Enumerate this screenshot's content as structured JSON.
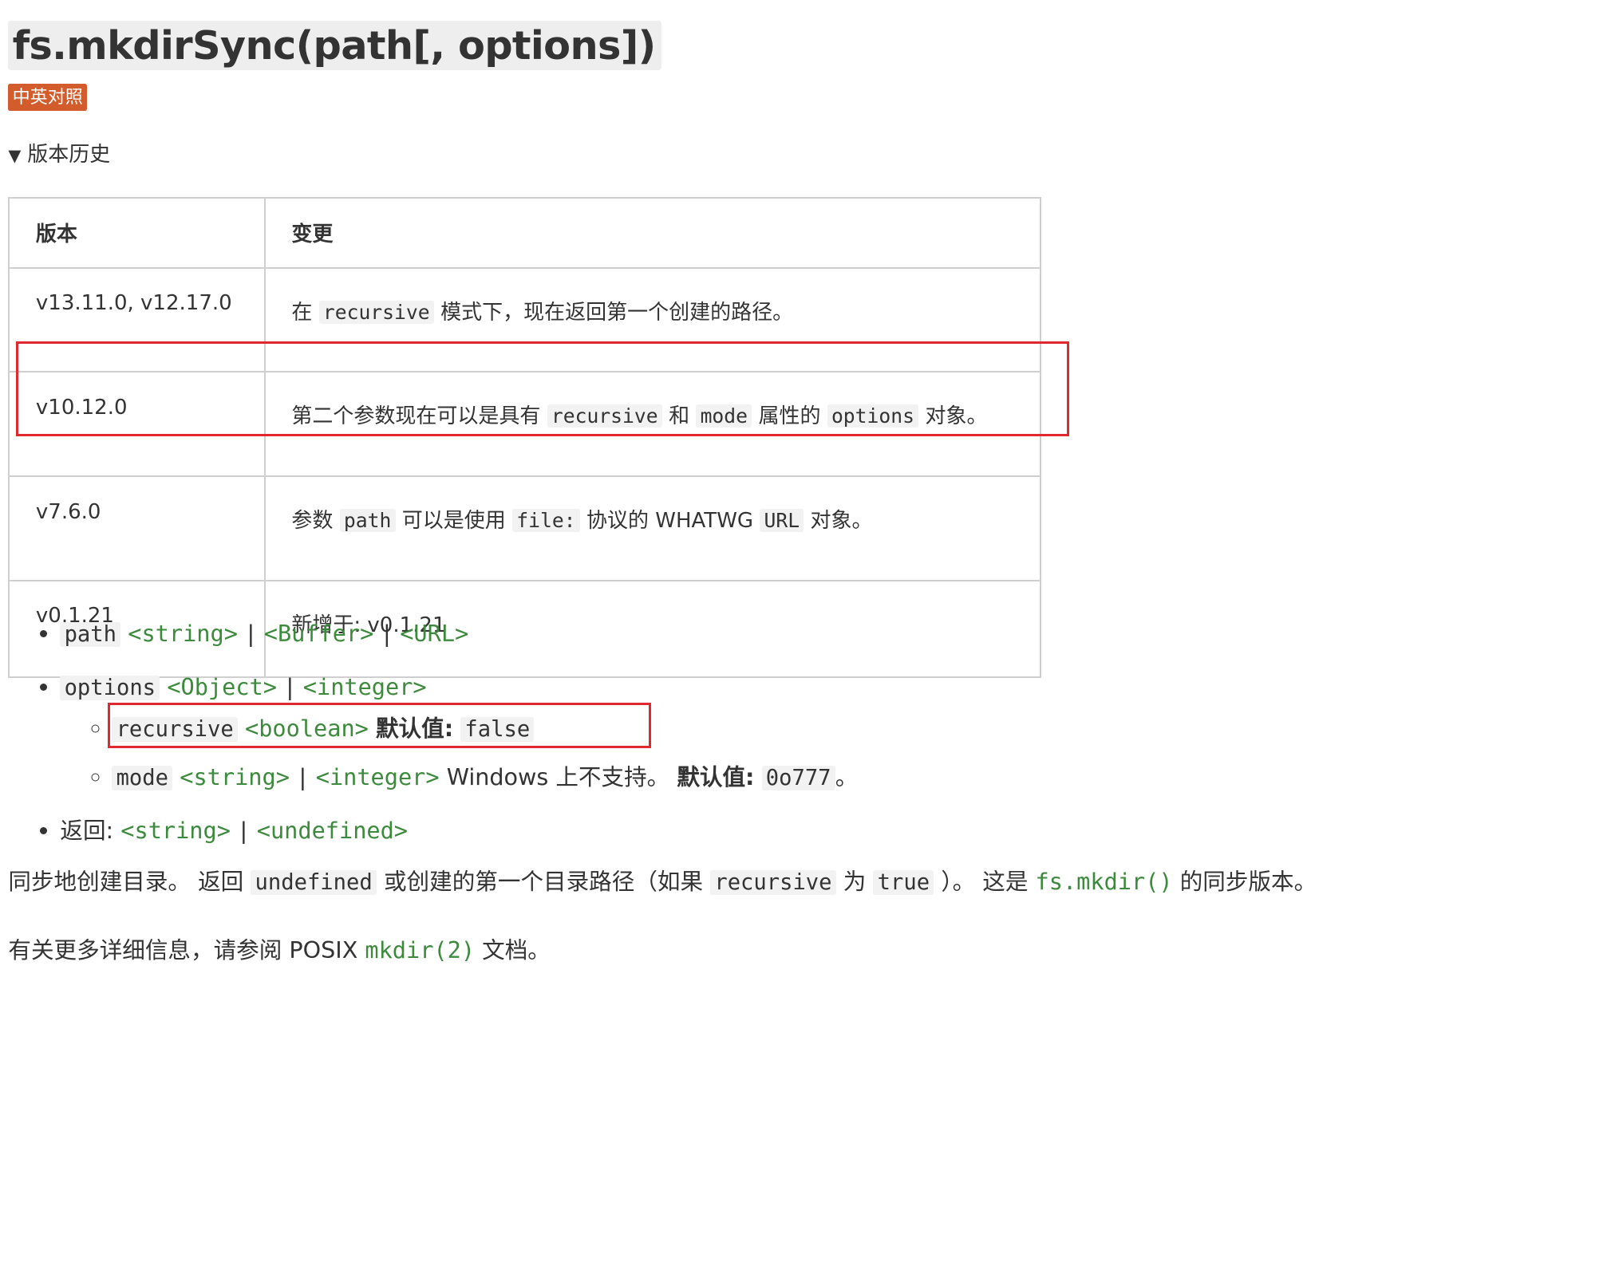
{
  "title": "fs.mkdirSync(path[, options])",
  "badge": "中英对照",
  "history": {
    "toggle_label": "版本历史",
    "headers": {
      "version": "版本",
      "change": "变更"
    },
    "rows": [
      {
        "version": "v13.11.0, v12.17.0",
        "c0": "在",
        "code0": "recursive",
        "c1": "模式下，现在返回第一个创建的路径。"
      },
      {
        "version": "v10.12.0",
        "c0": "第二个参数现在可以是具有",
        "code0": "recursive",
        "c1": "和",
        "code1": "mode",
        "c2": "属性的",
        "code2": "options",
        "c3": "对象。"
      },
      {
        "version": "v7.6.0",
        "c0": "参数",
        "code0": "path",
        "c1": "可以是使用",
        "code1": "file:",
        "c2": "协议的 WHATWG",
        "code2": "URL",
        "c3": "对象。"
      },
      {
        "version": "v0.1.21",
        "c0": "新增于: v0.1.21"
      }
    ]
  },
  "params": {
    "path": {
      "name": "path",
      "t1": "<string>",
      "t2": "<Buffer>",
      "t3": "<URL>",
      "sep": "|"
    },
    "options": {
      "name": "options",
      "t1": "<Object>",
      "t2": "<integer>",
      "sep": "|",
      "recursive": {
        "name": "recursive",
        "type": "<boolean>",
        "default_label": "默认值:",
        "default": "false"
      },
      "mode": {
        "name": "mode",
        "t1": "<string>",
        "t2": "<integer>",
        "note": "Windows 上不支持。",
        "default_label": "默认值:",
        "default": "0o777",
        "end": "。"
      }
    },
    "returns": {
      "label": "返回:",
      "t1": "<string>",
      "t2": "<undefined>",
      "sep": "|"
    }
  },
  "description": {
    "p1": {
      "s0": "同步地创建目录。 返回",
      "code0": "undefined",
      "s1": "或创建的第一个目录路径（如果",
      "code1": "recursive",
      "s2": "为",
      "code2": "true",
      "s3": "）。 这是",
      "link": "fs.mkdir()",
      "s4": "的同步版本。"
    },
    "p2": {
      "s0": "有关更多详细信息，请参阅 POSIX",
      "link": "mkdir(2)",
      "s1": "文档。"
    }
  },
  "colors": {
    "badge": "#d35c2c",
    "type_link": "#3c8a3c",
    "highlight_box": "#e0282f",
    "code_bg": "#f2f2f2"
  }
}
